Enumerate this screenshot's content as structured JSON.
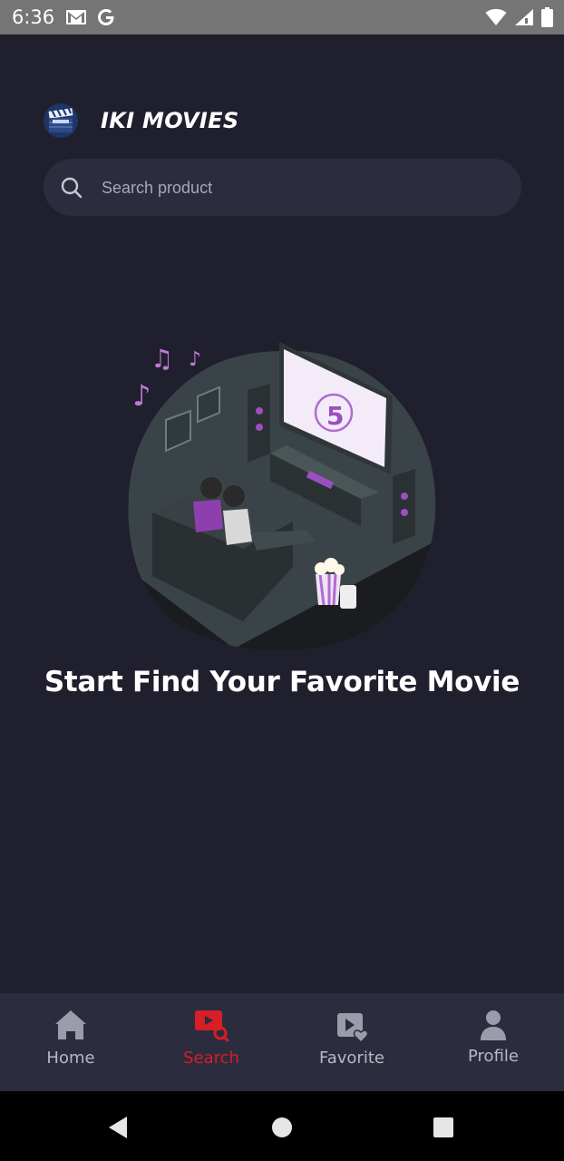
{
  "status_bar": {
    "time": "6:36",
    "left_icons": [
      "gmail-icon",
      "google-icon"
    ],
    "right_icons": [
      "wifi-icon",
      "signal-icon",
      "battery-icon"
    ]
  },
  "header": {
    "title": "IKI MOVIES",
    "logo_icon": "clapperboard-logo-icon"
  },
  "search": {
    "placeholder": "Search product",
    "value": ""
  },
  "empty_state": {
    "illustration": "home-theater-couple-illustration",
    "title": "Start Find Your Favorite Movie"
  },
  "bottom_nav": {
    "items": [
      {
        "label": "Home",
        "icon": "home-icon",
        "active": false
      },
      {
        "label": "Search",
        "icon": "video-search-icon",
        "active": true
      },
      {
        "label": "Favorite",
        "icon": "video-heart-icon",
        "active": false
      },
      {
        "label": "Profile",
        "icon": "person-icon",
        "active": false
      }
    ]
  },
  "colors": {
    "background": "#201f2e",
    "surface": "#2b2c3d",
    "accent": "#d81e27",
    "inactive": "#b7b8c4"
  }
}
